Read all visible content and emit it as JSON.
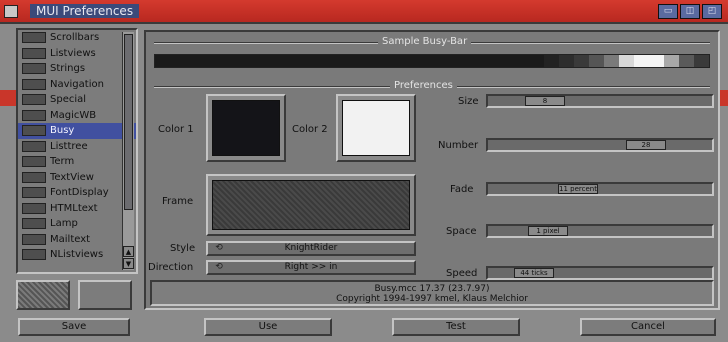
{
  "window": {
    "title": "MUI Preferences",
    "title_bg": "#3b4a7a",
    "titlebar_color": "#c9362a",
    "gadgets": [
      "▭",
      "◫",
      "◰"
    ]
  },
  "sidebar": {
    "items": [
      {
        "label": "Scrollbars",
        "icon": "scrollbars-icon"
      },
      {
        "label": "Listviews",
        "icon": "listviews-icon"
      },
      {
        "label": "Strings",
        "icon": "strings-icon"
      },
      {
        "label": "Navigation",
        "icon": "navigation-icon"
      },
      {
        "label": "Special",
        "icon": "special-icon"
      },
      {
        "label": "MagicWB",
        "icon": "magicwb-icon"
      },
      {
        "label": "Busy",
        "icon": "busy-icon",
        "selected": true
      },
      {
        "label": "Listtree",
        "icon": "listtree-icon"
      },
      {
        "label": "Term",
        "icon": "term-icon"
      },
      {
        "label": "TextView",
        "icon": "textview-icon"
      },
      {
        "label": "FontDisplay",
        "icon": "fontdisplay-icon"
      },
      {
        "label": "HTMLtext",
        "icon": "htmltext-icon"
      },
      {
        "label": "Lamp",
        "icon": "lamp-icon"
      },
      {
        "label": "Mailtext",
        "icon": "mailtext-icon"
      },
      {
        "label": "NListviews",
        "icon": "nlistviews-icon"
      }
    ],
    "selected_color": "#4150a0"
  },
  "busy_bar": {
    "title": "Sample Busy-Bar",
    "colors": [
      "#1a1a1a",
      "#1a1a1a",
      "#1a1a1a",
      "#1a1a1a",
      "#1a1a1a",
      "#1a1a1a",
      "#1a1a1a",
      "#1a1a1a",
      "#1a1a1a",
      "#1a1a1a",
      "#1a1a1a",
      "#1a1a1a",
      "#1a1a1a",
      "#1a1a1a",
      "#1a1a1a",
      "#1a1a1a",
      "#1a1a1a",
      "#1a1a1a",
      "#1a1a1a",
      "#1a1a1a",
      "#1a1a1a",
      "#1a1a1a",
      "#1a1a1a",
      "#1a1a1a",
      "#1a1a1a",
      "#1a1a1a",
      "#222222",
      "#2d2d2d",
      "#3a3a3a",
      "#555555",
      "#7a7a7a",
      "#d8d8d8",
      "#f4f4f4",
      "#f4f4f4",
      "#a8a8a8",
      "#5a5a5a",
      "#3a3a3a"
    ]
  },
  "preferences": {
    "title": "Preferences",
    "color1_label": "Color 1",
    "color1_value": "#141418",
    "color2_label": "Color 2",
    "color2_value": "#f2f2f2",
    "frame_label": "Frame",
    "style_label": "Style",
    "style_value": "KnightRider",
    "direction_label": "Direction",
    "direction_value": "Right >> in",
    "size_label": "Size",
    "size_value": "8",
    "size_fraction": 0.2,
    "number_label": "Number",
    "number_value": "28",
    "number_fraction": 0.75,
    "fade_label": "Fade",
    "fade_value": "11 percent",
    "fade_fraction": 0.38,
    "space_label": "Space",
    "space_value": "1 pixel",
    "space_fraction": 0.22,
    "speed_label": "Speed",
    "speed_value": "44 ticks",
    "speed_fraction": 0.14,
    "info_line1": "Busy.mcc 17.37 (23.7.97)",
    "info_line2": "Copyright 1994-1997 kmel, Klaus Melchior"
  },
  "buttons": {
    "save": "Save",
    "use": "Use",
    "test": "Test",
    "cancel": "Cancel"
  }
}
